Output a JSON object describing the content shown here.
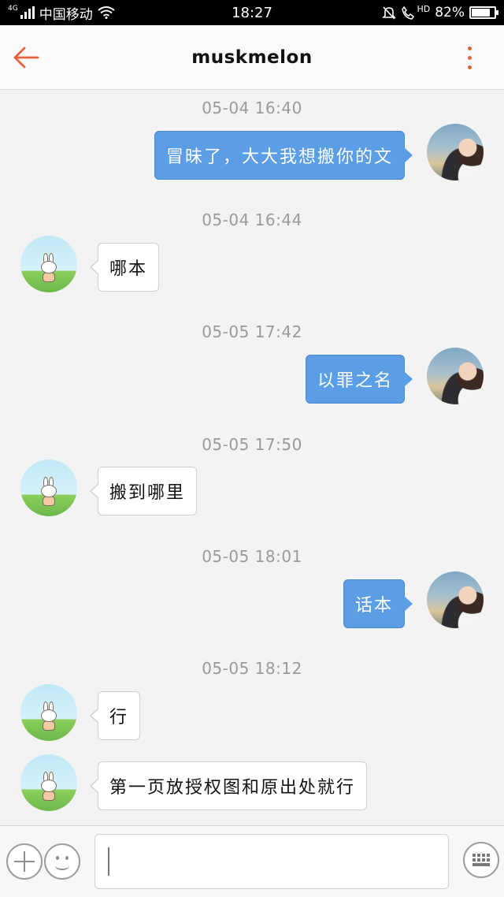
{
  "status_bar": {
    "network": "4G",
    "carrier": "中国移动",
    "time": "18:27",
    "hd_label": "HD",
    "battery": "82%",
    "battery_level": 0.82,
    "icons": [
      "signal-icon",
      "wifi-icon",
      "mute-bell-icon",
      "call-hd-icon",
      "battery-icon"
    ]
  },
  "header": {
    "title": "muskmelon",
    "back_icon": "back-arrow-icon",
    "menu_icon": "more-vertical-icon",
    "accent_color": "#e8613d"
  },
  "messages": [
    {
      "timestamp": "05-04 16:40",
      "sender": "self",
      "text": "冒昧了，大大我想搬你的文"
    },
    {
      "timestamp": "05-04 16:44",
      "sender": "other",
      "text": "哪本"
    },
    {
      "timestamp": "05-05 17:42",
      "sender": "self",
      "text": "以罪之名"
    },
    {
      "timestamp": "05-05 17:50",
      "sender": "other",
      "text": "搬到哪里"
    },
    {
      "timestamp": "05-05 18:01",
      "sender": "self",
      "text": "话本"
    },
    {
      "timestamp": "05-05 18:12",
      "sender": "other",
      "text": "行"
    },
    {
      "timestamp": "",
      "sender": "other",
      "text": "第一页放授权图和原出处就行"
    }
  ],
  "colors": {
    "self_bubble": "#5b9ee5",
    "other_bubble": "#ffffff",
    "timestamp": "#9a9a9a"
  },
  "input_bar": {
    "value": "",
    "icons": [
      "plus-icon",
      "emoji-icon",
      "keyboard-icon"
    ]
  }
}
